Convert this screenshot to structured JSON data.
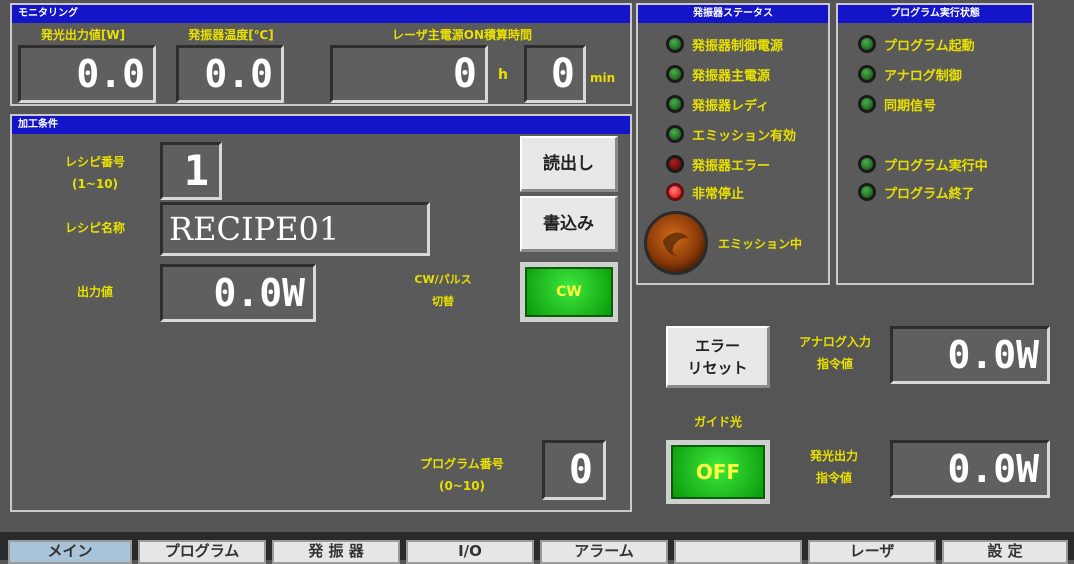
{
  "monitoring": {
    "title": "モニタリング",
    "laser_output_label": "発光出力値[W]",
    "laser_output_value": "0.0",
    "temp_label": "発振器温度[℃]",
    "temp_value": "0.0",
    "power_time_label": "レーザ主電源ON積算時間",
    "hours_value": "0",
    "hours_unit": "h",
    "minutes_value": "0",
    "minutes_unit": "min"
  },
  "processing": {
    "title": "加工条件",
    "recipe_no_label": "レシピ番号",
    "recipe_no_range": "(1~10)",
    "recipe_no_value": "1",
    "recipe_name_label": "レシピ名称",
    "recipe_name_value": "RECIPE01",
    "output_label": "出力値",
    "output_value": "0.0W",
    "cw_pulse_label_1": "CW/パルス",
    "cw_pulse_label_2": "切替",
    "cw_button": "CW",
    "read_button": "読出し",
    "write_button": "書込み",
    "program_no_label": "プログラム番号",
    "program_no_range": "(0~10)",
    "program_no_value": "0"
  },
  "osc_status": {
    "title": "発振器ステータス",
    "items": [
      {
        "label": "発振器制御電源",
        "state": "green"
      },
      {
        "label": "発振器主電源",
        "state": "green"
      },
      {
        "label": "発振器レディ",
        "state": "green"
      },
      {
        "label": "エミッション有効",
        "state": "green"
      },
      {
        "label": "発振器エラー",
        "state": "darkred"
      },
      {
        "label": "非常停止",
        "state": "red"
      }
    ],
    "emission_label": "エミッション中"
  },
  "program_status": {
    "title": "プログラム実行状態",
    "items": [
      {
        "label": "プログラム起動",
        "state": "green"
      },
      {
        "label": "アナログ制御",
        "state": "green"
      },
      {
        "label": "同期信号",
        "state": "green"
      },
      {
        "label": "プログラム実行中",
        "state": "green"
      },
      {
        "label": "プログラム終了",
        "state": "green"
      }
    ]
  },
  "controls": {
    "error_reset_line1": "エラー",
    "error_reset_line2": "リセット",
    "analog_label_1": "アナログ入力",
    "analog_label_2": "指令値",
    "analog_value": "0.0W",
    "guide_label": "ガイド光",
    "guide_button": "OFF",
    "output_cmd_label_1": "発光出力",
    "output_cmd_label_2": "指令値",
    "output_cmd_value": "0.0W"
  },
  "tabs": [
    {
      "label": "メイン",
      "active": true
    },
    {
      "label": "プログラム"
    },
    {
      "label": "発 振 器"
    },
    {
      "label": "I/O"
    },
    {
      "label": "アラーム"
    },
    {
      "label": ""
    },
    {
      "label": "レーザ"
    },
    {
      "label": "設 定"
    }
  ]
}
